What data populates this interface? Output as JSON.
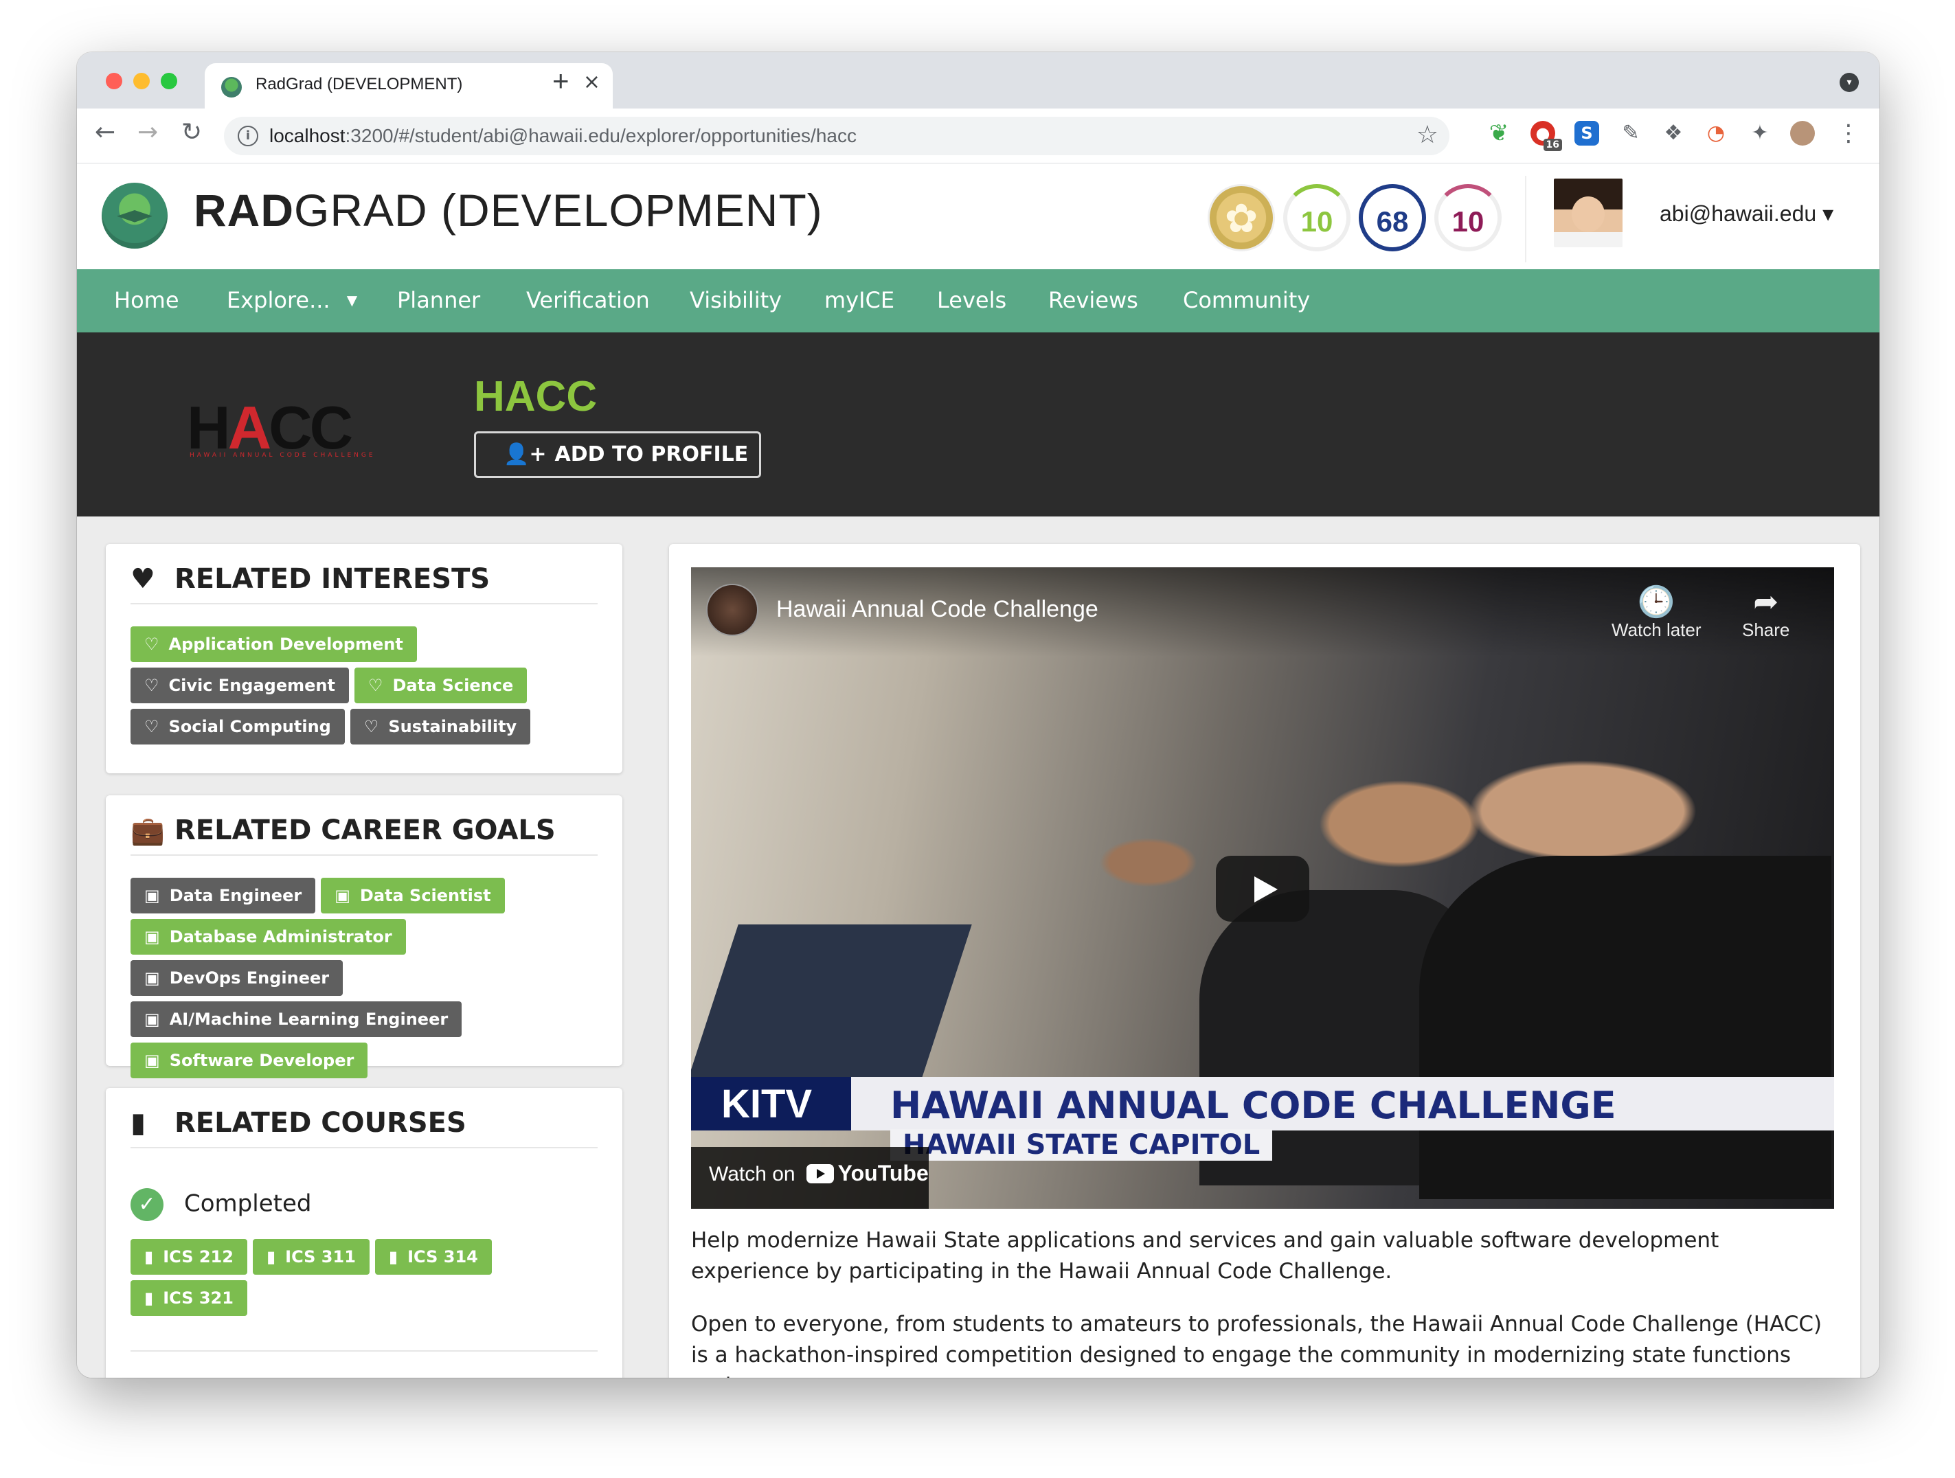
{
  "browser": {
    "tab_title": "RadGrad (DEVELOPMENT)",
    "url_host": "localhost",
    "url_rest": ":3200/#/student/abi@hawaii.edu/explorer/opportunities/hacc",
    "extension_badge": "16"
  },
  "header": {
    "brand_bold": "RAD",
    "brand_rest": "GRAD (DEVELOPMENT)",
    "innovation_points": "10",
    "competency_points": "68",
    "experience_points": "10",
    "user": "abi@hawaii.edu"
  },
  "nav": [
    "Home",
    "Explore...",
    "Planner",
    "Verification",
    "Visibility",
    "myICE",
    "Levels",
    "Reviews",
    "Community"
  ],
  "opportunity": {
    "logo_text_h": "H",
    "logo_text_a": "A",
    "logo_text_cc": "CC",
    "logo_tagline": "HAWAII ANNUAL CODE CHALLENGE",
    "title": "HACC",
    "add_button": "ADD TO PROFILE"
  },
  "related_interests": {
    "heading": "RELATED INTERESTS",
    "items": [
      {
        "label": "Application Development",
        "color": "#7cbd4f"
      },
      {
        "label": "Civic Engagement",
        "color": "#5f5f5f"
      },
      {
        "label": "Data Science",
        "color": "#7cbd4f"
      },
      {
        "label": "Social Computing",
        "color": "#5f5f5f"
      },
      {
        "label": "Sustainability",
        "color": "#5f5f5f"
      }
    ]
  },
  "related_career_goals": {
    "heading": "RELATED CAREER GOALS",
    "items": [
      {
        "label": "Data Engineer",
        "color": "#5f5f5f"
      },
      {
        "label": "Data Scientist",
        "color": "#7cbd4f"
      },
      {
        "label": "Database Administrator",
        "color": "#7cbd4f"
      },
      {
        "label": "DevOps Engineer",
        "color": "#5f5f5f"
      },
      {
        "label": "AI/Machine Learning Engineer",
        "color": "#5f5f5f"
      },
      {
        "label": "Software Developer",
        "color": "#7cbd4f"
      }
    ]
  },
  "related_courses": {
    "heading": "RELATED COURSES",
    "completed_label": "Completed",
    "completed": [
      "ICS 212",
      "ICS 311",
      "ICS 314",
      "ICS 321"
    ]
  },
  "video": {
    "title": "Hawaii Annual Code Challenge",
    "watch_later": "Watch later",
    "share": "Share",
    "station": "KITV",
    "headline": "HAWAII ANNUAL CODE CHALLENGE",
    "subheadline": "HAWAII STATE CAPITOL",
    "watch_on": "Watch on",
    "youtube": "YouTube"
  },
  "description": [
    "Help modernize Hawaii State applications and services and gain valuable software development experience by participating in the Hawaii Annual Code Challenge.",
    "Open to everyone, from students to amateurs to professionals, the Hawaii Annual Code Challenge (HACC) is a hackathon-inspired competition designed to engage the community in modernizing state functions and"
  ]
}
